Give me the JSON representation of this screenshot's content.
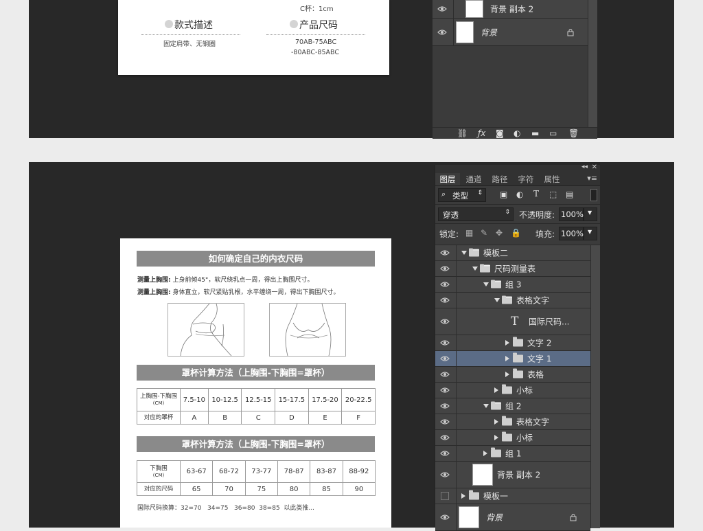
{
  "top_document": {
    "partial_text": "C杯：1cm",
    "style_title": "款式描述",
    "style_text": "固定肩带、无钢圈",
    "size_title": "产品尺码",
    "size_line1": "70AB-75ABC",
    "size_line2": "-80ABC-85ABC"
  },
  "top_layers": [
    {
      "name": "背景 副本 2",
      "locked": false
    },
    {
      "name": "背景",
      "locked": true
    }
  ],
  "document": {
    "title": "如何确定自己的内衣尺码",
    "measure1_label": "测量上胸围:",
    "measure1_text": "上身前倾45°，软尺绕乳点一周，得出上胸围尺寸。",
    "measure2_label": "测量上胸围:",
    "measure2_text": "身体直立，软尺紧贴乳根，水平缠绕一周，得出下胸围尺寸。",
    "cup_title": "罩杯计算方法（上胸围-下胸围=罩杯）",
    "cup_table": {
      "header_main": "上胸围-下胸围",
      "header_unit": "(CM)",
      "ranges": [
        "7.5-10",
        "10-12.5",
        "12.5-15",
        "15-17.5",
        "17.5-20",
        "20-22.5"
      ],
      "row_label": "对应的罩杯",
      "cups": [
        "A",
        "B",
        "C",
        "D",
        "E",
        "F"
      ]
    },
    "size_title": "罩杯计算方法（上胸围-下胸围=罩杯）",
    "size_table": {
      "header_main": "下胸围",
      "header_unit": "(CM)",
      "ranges": [
        "63-67",
        "68-72",
        "73-77",
        "78-87",
        "83-87",
        "88-92"
      ],
      "row_label": "对应的尺码",
      "sizes": [
        "65",
        "70",
        "75",
        "80",
        "85",
        "90"
      ]
    },
    "footer": "国际尺码换算：32=70   34=75   36=80  38=85  以此类推..."
  },
  "layers_panel": {
    "tabs": [
      "图层",
      "通道",
      "路径",
      "字符",
      "属性"
    ],
    "filter_label": "类型",
    "blend_mode": "穿透",
    "opacity_label": "不透明度:",
    "opacity_value": "100%",
    "lock_label": "锁定:",
    "fill_label": "填充:",
    "fill_value": "100%",
    "layers": [
      {
        "name": "模板二",
        "type": "folder",
        "indent": 0,
        "expanded": true,
        "visible": true
      },
      {
        "name": "尺码测量表",
        "type": "folder",
        "indent": 1,
        "expanded": true,
        "visible": true
      },
      {
        "name": "组 3",
        "type": "folder",
        "indent": 2,
        "expanded": true,
        "visible": true
      },
      {
        "name": "表格文字",
        "type": "folder",
        "indent": 3,
        "expanded": true,
        "visible": true
      },
      {
        "name": "国际尺码...",
        "type": "text",
        "indent": 4,
        "visible": true
      },
      {
        "name": "文字 2",
        "type": "folder",
        "indent": 4,
        "expanded": false,
        "visible": true
      },
      {
        "name": "文字 1",
        "type": "folder",
        "indent": 4,
        "expanded": false,
        "visible": true,
        "selected": true
      },
      {
        "name": "表格",
        "type": "folder",
        "indent": 4,
        "expanded": false,
        "visible": true
      },
      {
        "name": "小标",
        "type": "folder",
        "indent": 3,
        "expanded": false,
        "visible": true
      },
      {
        "name": "组 2",
        "type": "folder",
        "indent": 2,
        "expanded": true,
        "visible": true
      },
      {
        "name": "表格文字",
        "type": "folder",
        "indent": 3,
        "expanded": false,
        "visible": true
      },
      {
        "name": "小标",
        "type": "folder",
        "indent": 3,
        "expanded": false,
        "visible": true
      },
      {
        "name": "组 1",
        "type": "folder",
        "indent": 2,
        "expanded": false,
        "visible": true
      },
      {
        "name": "背景 副本 2",
        "type": "image",
        "indent": 1,
        "visible": true
      },
      {
        "name": "模板一",
        "type": "folder",
        "indent": 0,
        "expanded": false,
        "visible": false
      },
      {
        "name": "背景",
        "type": "image",
        "indent": 0,
        "visible": true,
        "locked": true
      }
    ]
  },
  "colors": {
    "canvas": "#282828",
    "panel": "#3b3b3b",
    "selected": "#5b6c86",
    "banner": "#8a8a8a"
  }
}
